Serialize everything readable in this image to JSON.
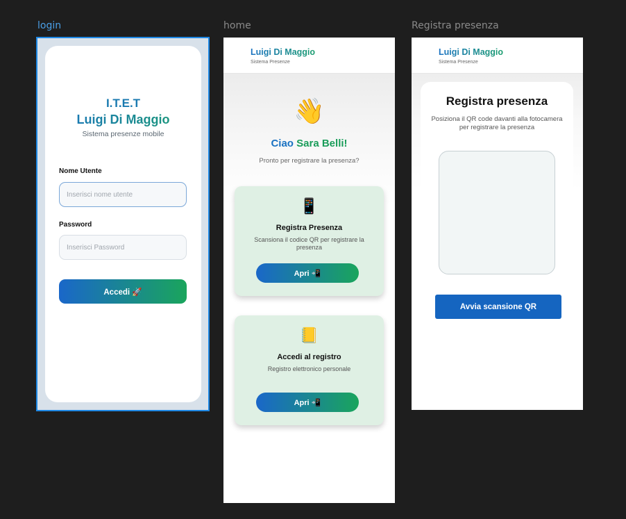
{
  "frames": {
    "login_label": "login",
    "home_label": "home",
    "registra_label": "Registra presenza"
  },
  "login": {
    "title_line1": "I.T.E.T",
    "title_line2": "Luigi Di Maggio",
    "subtitle": "Sistema presenze mobile",
    "username_label": "Nome Utente",
    "username_placeholder": "Inserisci nome utente",
    "password_label": "Password",
    "password_placeholder": "Inserisci Password",
    "submit_label": "Accedi 🚀"
  },
  "header": {
    "title": "Luigi Di Maggio",
    "subtitle": "Sistema Presenze"
  },
  "home": {
    "wave_emoji": "👋",
    "greeting_prefix": "Ciao ",
    "user_name": "Sara Belli!",
    "greeting_sub": "Pronto per registrare la presenza?",
    "cards": [
      {
        "icon": "📱",
        "title": "Registra  Presenza",
        "description": "Scansiona il codice QR per registrare la presenza",
        "button_label": "Apri 📲"
      },
      {
        "icon": "📒",
        "title": "Accedi al registro",
        "description": "Registro elettronico  personale",
        "button_label": "Apri 📲"
      }
    ]
  },
  "registra": {
    "title": "Registra presenza",
    "description": "Posiziona  il QR code davanti alla fotocamera per registrare la presenza",
    "scan_button_label": "Avvia scansione QR"
  },
  "colors": {
    "accent_blue": "#1a72c2",
    "accent_green": "#1a9d5a",
    "card_bg": "#dff0e4",
    "scan_button": "#1565c0",
    "selection": "#1e88e5"
  }
}
